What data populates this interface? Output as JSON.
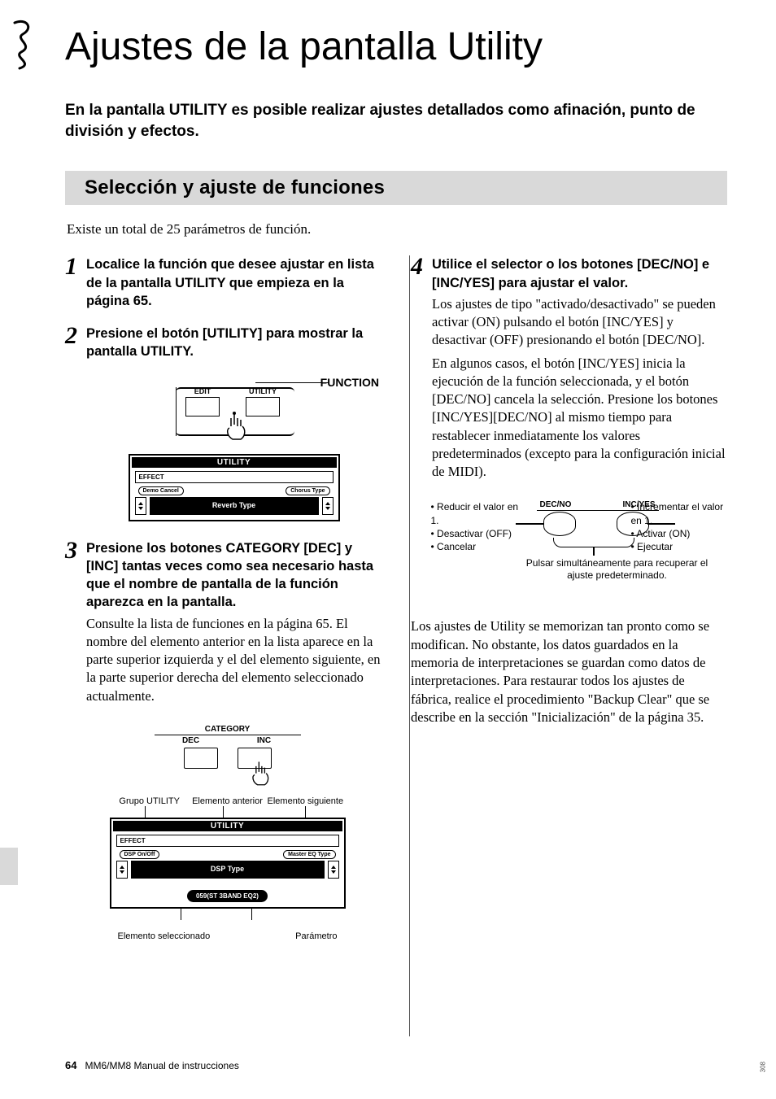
{
  "title": "Ajustes de la pantalla Utility",
  "lead": "En la pantalla UTILITY es posible realizar ajustes detallados como afinación, punto de división y efectos.",
  "section": "Selección y ajuste de funciones",
  "intro": "Existe un total de 25 parámetros de función.",
  "steps": {
    "1": {
      "head": "Localice la función que desee ajustar en lista de la pantalla UTILITY que empieza en la página 65."
    },
    "2": {
      "head": "Presione el botón [UTILITY] para mostrar la pantalla UTILITY."
    },
    "3": {
      "head": "Presione los botones CATEGORY [DEC] y [INC] tantas veces como sea necesario hasta que el nombre de pantalla de la función aparezca en la pantalla.",
      "text": "Consulte la lista de funciones en la página 65. El nombre del elemento anterior en la lista aparece en la parte superior izquierda y el del elemento siguiente, en la parte superior derecha del elemento seleccionado actualmente."
    },
    "4": {
      "head": "Utilice el selector o los botones [DEC/NO] e [INC/YES] para ajustar el valor.",
      "text1": "Los ajustes de tipo \"activado/desactivado\" se pueden activar (ON) pulsando el botón [INC/YES] y desactivar (OFF) presionando el botón [DEC/NO].",
      "text2": "En algunos casos, el botón [INC/YES] inicia la ejecución de la función seleccionada, y el botón [DEC/NO] cancela la selección. Presione los botones [INC/YES][DEC/NO] al mismo tiempo para restablecer inmediatamente los valores predeterminados (excepto para la configuración inicial de MIDI)."
    }
  },
  "fig_function": {
    "function_label": "FUNCTION",
    "edit": "EDIT",
    "utility": "UTILITY"
  },
  "display1": {
    "title": "UTILITY",
    "group": "EFFECT",
    "left_tag": "Demo Cancel",
    "right_tag": "Chorus Type",
    "center": "Reverb Type"
  },
  "category": {
    "title": "CATEGORY",
    "dec": "DEC",
    "inc": "INC"
  },
  "annot2": {
    "top_left": "Grupo UTILITY",
    "top_mid": "Elemento anterior",
    "top_right": "Elemento siguiente",
    "bot_left": "Elemento seleccionado",
    "bot_right": "Parámetro"
  },
  "display2": {
    "title": "UTILITY",
    "group": "EFFECT",
    "left_tag": "DSP On/Off",
    "right_tag": "Master EQ Type",
    "center": "DSP Type",
    "value": "059(ST 3BAND EQ2)"
  },
  "decinc": {
    "dec": "DEC/NO",
    "inc": "INC/YES",
    "left": [
      "Reducir el valor en 1.",
      "Desactivar (OFF)",
      "Cancelar"
    ],
    "right": [
      "Incrementar el valor en 1.",
      "Activar (ON)",
      "Ejecutar"
    ],
    "caption": "Pulsar simultáneamente para recuperar el ajuste predeterminado."
  },
  "after": "Los ajustes de Utility se memorizan tan pronto como se modifican. No obstante, los datos guardados en la memoria de interpretaciones se guardan como datos de interpretaciones. Para restaurar todos los ajustes de fábrica, realice el procedimiento \"Backup Clear\" que se describe en la sección \"Inicialización\" de la página 35.",
  "footer": {
    "page": "64",
    "doc": "MM6/MM8  Manual de instrucciones"
  },
  "side": "308"
}
